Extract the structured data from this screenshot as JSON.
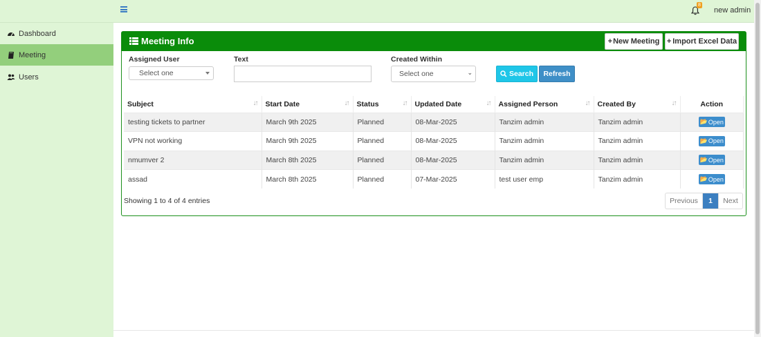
{
  "header": {
    "user": "new admin",
    "notification_count": "8"
  },
  "sidebar": {
    "items": [
      {
        "label": "Dashboard",
        "icon": "dashboard-icon"
      },
      {
        "label": "Meeting",
        "icon": "book-icon"
      },
      {
        "label": "Users",
        "icon": "users-icon"
      }
    ]
  },
  "panel": {
    "title": "Meeting Info",
    "new_button": "New Meeting",
    "import_button": "Import Excel Data"
  },
  "filters": {
    "assigned_user_label": "Assigned User",
    "assigned_user_value": "Select one",
    "text_label": "Text",
    "text_value": "",
    "created_within_label": "Created Within",
    "created_within_value": "Select one",
    "search_button": "Search",
    "refresh_button": "Refresh"
  },
  "table": {
    "columns": [
      "Subject",
      "Start Date",
      "Status",
      "Updated Date",
      "Assigned Person",
      "Created By",
      "Action"
    ],
    "rows": [
      [
        "testing tickets to partner",
        "March 9th 2025",
        "Planned",
        "08-Mar-2025",
        "Tanzim admin",
        "Tanzim admin",
        "Open"
      ],
      [
        "VPN not working",
        "March 9th 2025",
        "Planned",
        "08-Mar-2025",
        "Tanzim admin",
        "Tanzim admin",
        "Open"
      ],
      [
        "nmumver 2",
        "March 8th 2025",
        "Planned",
        "08-Mar-2025",
        "Tanzim admin",
        "Tanzim admin",
        "Open"
      ],
      [
        "assad",
        "March 8th 2025",
        "Planned",
        "07-Mar-2025",
        "test user emp",
        "Tanzim admin",
        "Open"
      ]
    ]
  },
  "pagination": {
    "info": "Showing 1 to 4 of 4 entries",
    "previous": "Previous",
    "current": "1",
    "next": "Next"
  },
  "colors": {
    "accent_green": "#0a8c0a",
    "sidebar_bg": "#dff5d6",
    "active_item": "#93cf7c"
  }
}
